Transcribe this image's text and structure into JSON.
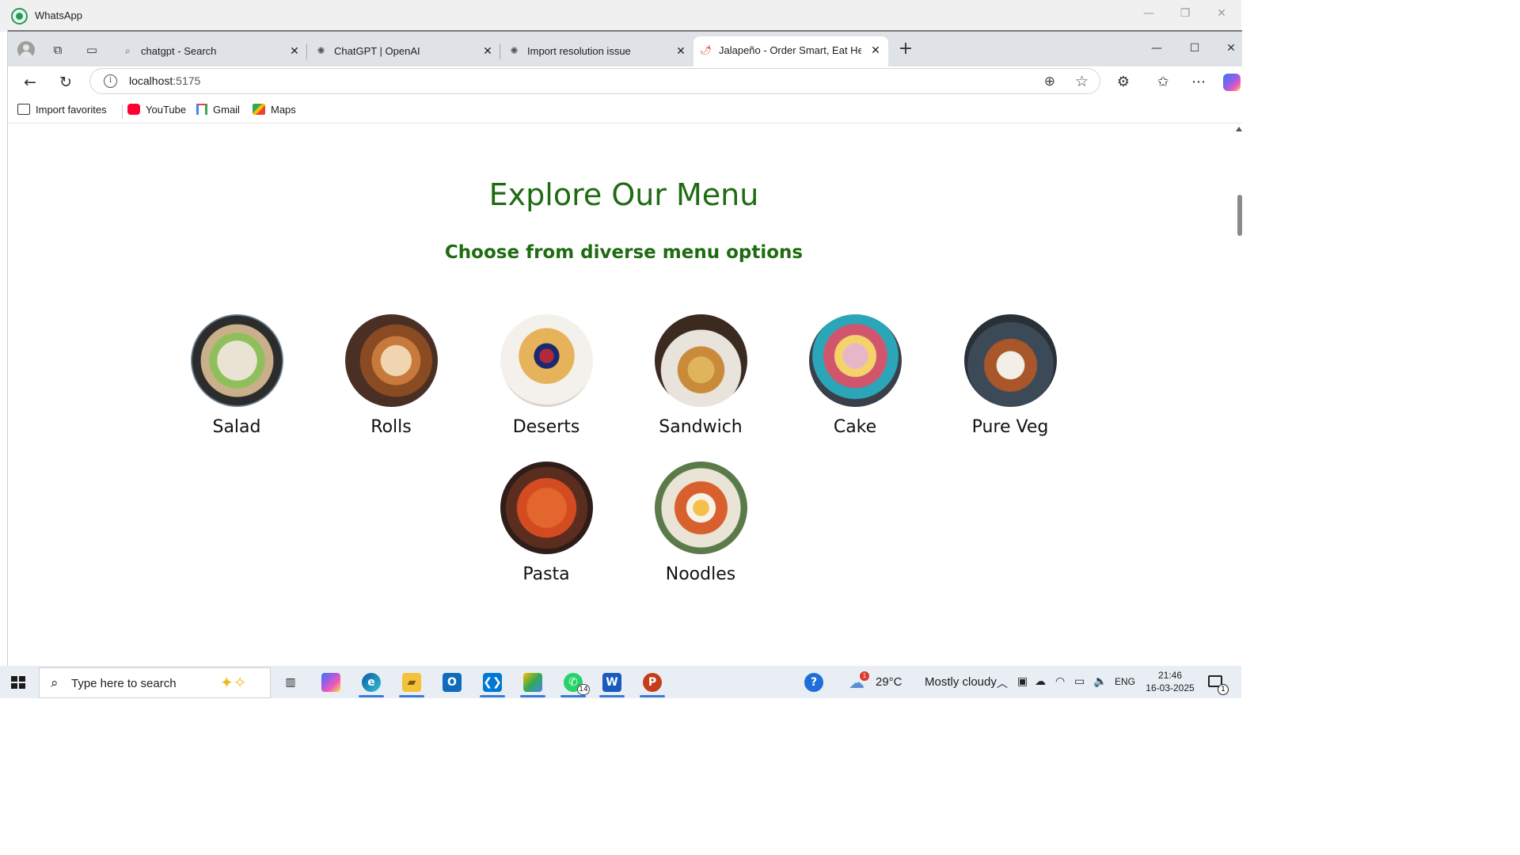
{
  "outer_window": {
    "app_name": "WhatsApp",
    "minimize": "—",
    "restore": "❐",
    "close": "✕"
  },
  "browser": {
    "tabs": [
      {
        "title": "chatgpt - Search",
        "icon": "search-icon",
        "active": false
      },
      {
        "title": "ChatGPT | OpenAI",
        "icon": "openai-icon",
        "active": false
      },
      {
        "title": "Import resolution issue",
        "icon": "openai-icon",
        "active": false
      },
      {
        "title": "Jalapeño - Order Smart, Eat Healthy",
        "icon": "jalapeno-icon",
        "active": true
      }
    ],
    "new_tab": "+",
    "window_controls": {
      "minimize": "—",
      "maximize": "☐",
      "close": "✕"
    },
    "address": {
      "host": "localhost",
      "port": ":5175"
    },
    "favorites": [
      {
        "label": "Import favorites",
        "icon": "import-favorites-icon"
      },
      {
        "label": "YouTube",
        "icon": "youtube-icon"
      },
      {
        "label": "Gmail",
        "icon": "gmail-icon"
      },
      {
        "label": "Maps",
        "icon": "maps-icon"
      }
    ]
  },
  "page": {
    "title": "Explore Our Menu",
    "subtitle": "Choose from diverse menu options",
    "menu_items": [
      {
        "name": "Salad"
      },
      {
        "name": "Rolls"
      },
      {
        "name": "Deserts"
      },
      {
        "name": "Sandwich"
      },
      {
        "name": "Cake"
      },
      {
        "name": "Pure Veg"
      },
      {
        "name": "Pasta"
      },
      {
        "name": "Noodles"
      }
    ],
    "accent_color": "#1f6b12"
  },
  "taskbar": {
    "search_placeholder": "Type here to search",
    "whatsapp_badge": "14",
    "weather": {
      "temp": "29°C",
      "condition": "Mostly cloudy",
      "alert": "1"
    },
    "language": "ENG",
    "time": "21:46",
    "date": "16-03-2025",
    "notifications": "1"
  }
}
